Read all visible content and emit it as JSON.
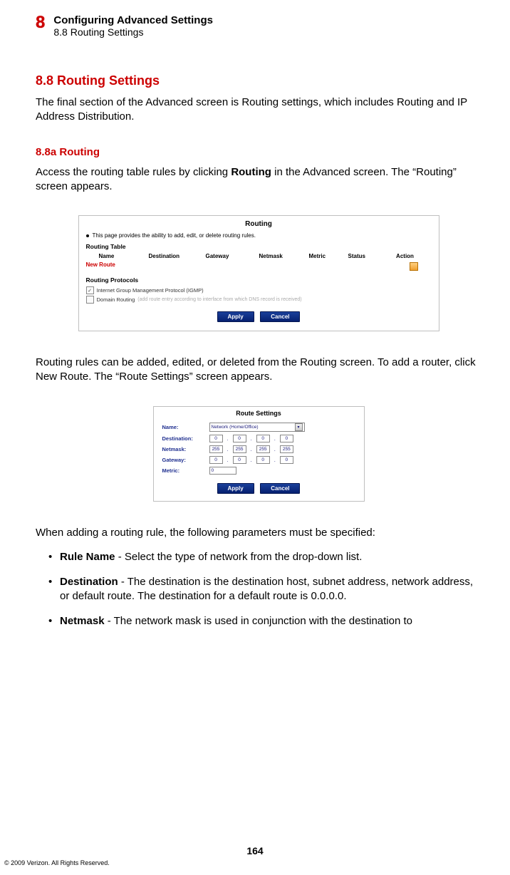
{
  "header": {
    "chapter_number": "8",
    "chapter_title": "Configuring Advanced Settings",
    "breadcrumb": "8.8 Routing Settings"
  },
  "section": {
    "title": "8.8 Routing Settings",
    "intro": "The final section of the Advanced screen is Routing settings, which includes Routing and IP Address Distribution."
  },
  "subsection_a": {
    "title": "8.8a  Routing",
    "intro_pre": "Access the routing table rules by clicking ",
    "intro_bold": "Routing",
    "intro_post": " in the Advanced screen. The “Routing” screen appears."
  },
  "routing_panel": {
    "title": "Routing",
    "note": "This page provides the ability to add, edit, or delete routing rules.",
    "table_heading": "Routing Table",
    "cols": {
      "name": "Name",
      "destination": "Destination",
      "gateway": "Gateway",
      "netmask": "Netmask",
      "metric": "Metric",
      "status": "Status",
      "action": "Action"
    },
    "new_route": "New Route",
    "protocols_heading": "Routing Protocols",
    "igmp_label": "Internet Group Management Protocol (IGMP)",
    "domain_routing_label": "Domain Routing",
    "domain_routing_hint": "(add route entry according to interface from which DNS record is received)",
    "apply": "Apply",
    "cancel": "Cancel"
  },
  "mid_para": "Routing rules can be added, edited, or deleted from the Routing screen. To add a router, click New Route. The “Route Settings” screen appears.",
  "route_settings_panel": {
    "title": "Route Settings",
    "name_label": "Name:",
    "name_value": "Network (Home/Office)",
    "destination_label": "Destination:",
    "destination_value": [
      "0",
      "0",
      "0",
      "0"
    ],
    "netmask_label": "Netmask:",
    "netmask_value": [
      "255",
      "255",
      "255",
      "255"
    ],
    "gateway_label": "Gateway:",
    "gateway_value": [
      "0",
      "0",
      "0",
      "0"
    ],
    "metric_label": "Metric:",
    "metric_value": "0",
    "apply": "Apply",
    "cancel": "Cancel"
  },
  "params_intro": "When adding a routing rule, the following parameters must be specified:",
  "params": {
    "rule_name_b": "Rule Name",
    "rule_name_t": " - Select the type of network from the drop-down list.",
    "destination_b": "Destination",
    "destination_t": " - The destination is the destination host, subnet address, network address, or default route. The destination for a default route is 0.0.0.0.",
    "netmask_b": "Netmask",
    "netmask_t": " - The network mask is used in conjunction with the destination to"
  },
  "footer": {
    "page_number": "164",
    "copyright": "© 2009 Verizon. All Rights Reserved."
  }
}
